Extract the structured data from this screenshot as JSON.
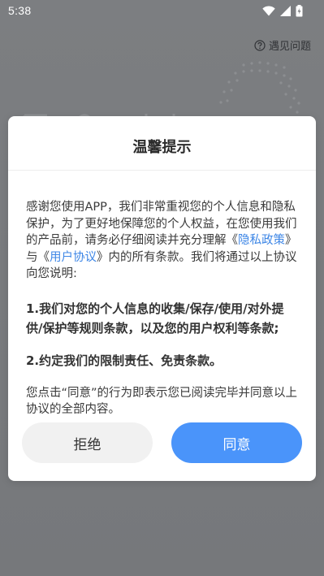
{
  "status_bar": {
    "time": "5:38",
    "icons": [
      "wifi-icon",
      "signal-icon",
      "battery-icon"
    ]
  },
  "header": {
    "help_label": "遇见问题",
    "help_icon": "question-circle-icon"
  },
  "dialog": {
    "title": "温馨提示",
    "intro_part1": "感谢您使用APP，我们非常重视您的个人信息和隐私保护，为了更好地保障您的个人权益，在您使用我们的产品前，请务必仔细阅读并充分理解《",
    "privacy_link": "隐私政策",
    "intro_part2": "》与《",
    "user_agreement_link": "用户协议",
    "intro_part3": "》内的所有条款。我们将通过以上协议向您说明:",
    "point1": "1.我们对您的个人信息的收集/保存/使用/对外提供/保护等规则条款，以及您的用户权利等条款;",
    "point2": "2.约定我们的限制责任、免责条款。",
    "closing": "您点击“同意”的行为即表示您已阅读完毕并同意以上协议的全部内容。",
    "reject_label": "拒绝",
    "agree_label": "同意"
  },
  "colors": {
    "overlay": "#7a7b7e",
    "link": "#3d86e6",
    "agree_button": "#4a94fa",
    "reject_button": "#f1f1f1"
  }
}
